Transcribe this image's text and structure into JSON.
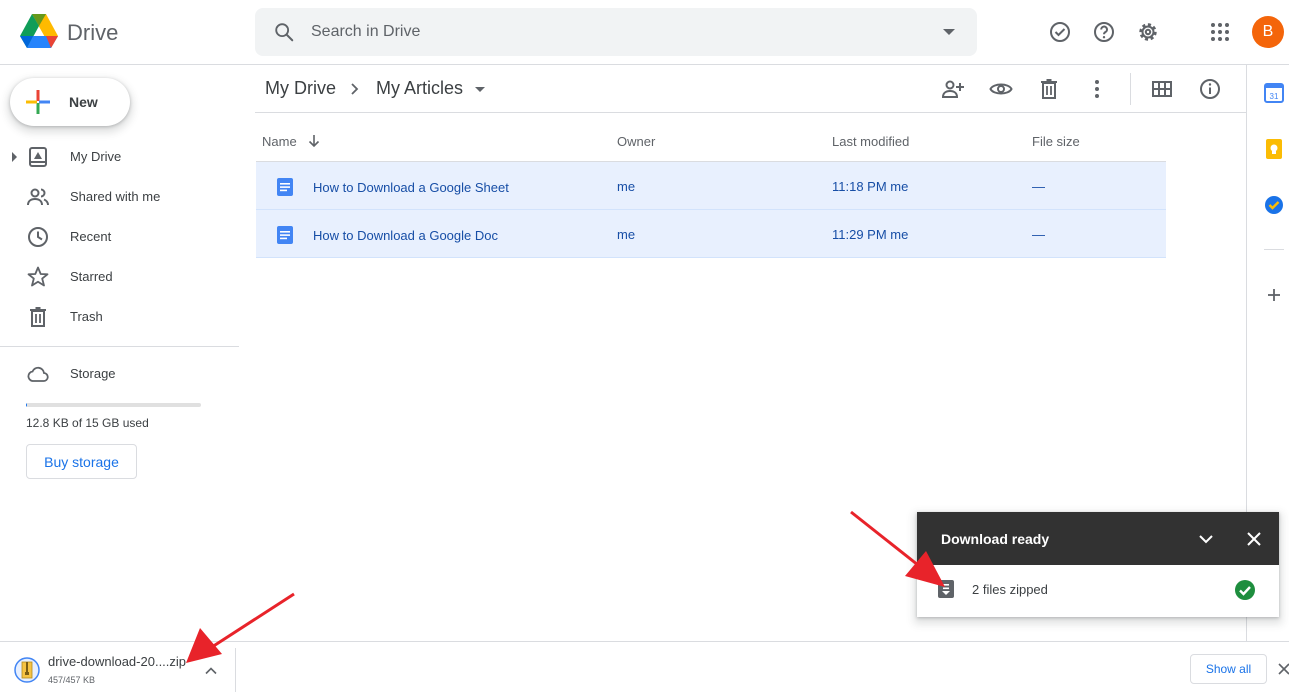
{
  "header": {
    "app_name": "Drive",
    "search_placeholder": "Search in Drive",
    "avatar_letter": "B",
    "icons": [
      "offline-ready-icon",
      "help-icon",
      "settings-icon",
      "apps-grid-icon"
    ]
  },
  "sidebar": {
    "new_label": "New",
    "items": [
      {
        "label": "My Drive",
        "icon": "my-drive-icon"
      },
      {
        "label": "Shared with me",
        "icon": "shared-icon"
      },
      {
        "label": "Recent",
        "icon": "clock-icon"
      },
      {
        "label": "Starred",
        "icon": "star-icon"
      },
      {
        "label": "Trash",
        "icon": "trash-icon"
      }
    ],
    "storage": {
      "label": "Storage",
      "used_text": "12.8 KB of 15 GB used",
      "used_fraction": 0.001,
      "buy_label": "Buy storage"
    }
  },
  "main": {
    "breadcrumb": [
      "My Drive",
      "My Articles"
    ],
    "columns": {
      "name": "Name",
      "owner": "Owner",
      "modified": "Last modified",
      "size": "File size"
    },
    "rows": [
      {
        "name": "How to Download a Google Sheet",
        "owner": "me",
        "modified": "11:18 PM  me",
        "size": "—"
      },
      {
        "name": "How to Download a Google Doc",
        "owner": "me",
        "modified": "11:29 PM  me",
        "size": "—"
      }
    ]
  },
  "toast": {
    "title": "Download ready",
    "file_label": "2 files zipped"
  },
  "download_bar": {
    "file_name": "drive-download-20....zip",
    "size": "457/457 KB",
    "show_all": "Show all"
  },
  "colors": {
    "accent": "#1a73e8",
    "selection": "#e8f0fe",
    "toast_bg": "#323232",
    "avatar": "#f4650a",
    "success": "#1e8e3e",
    "annotation_arrow": "#e8232a"
  }
}
